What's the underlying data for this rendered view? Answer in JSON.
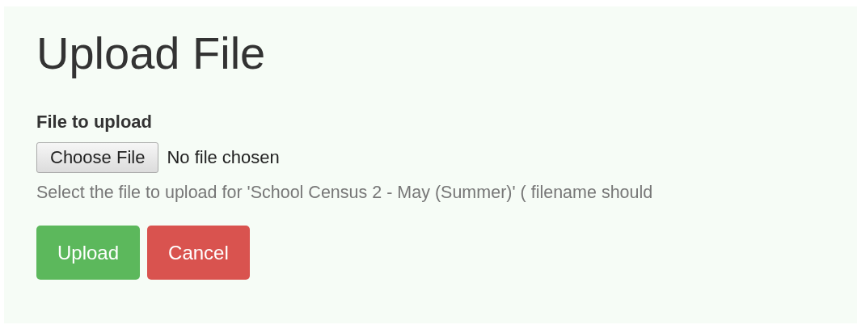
{
  "heading": "Upload File",
  "field": {
    "label": "File to upload",
    "button": "Choose File",
    "status": "No file chosen"
  },
  "help": "Select the file to upload for 'School Census 2 - May (Summer)' ( filename should",
  "buttons": [
    {
      "label": "Upload",
      "kind": "success"
    },
    {
      "label": "Cancel",
      "kind": "danger"
    }
  ]
}
